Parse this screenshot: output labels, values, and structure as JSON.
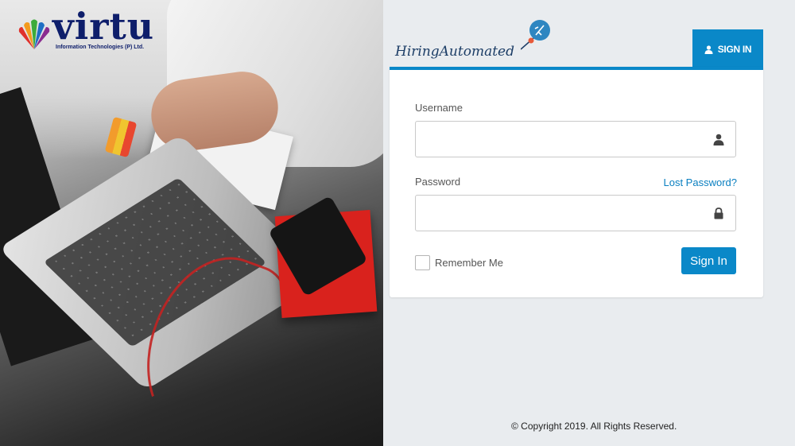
{
  "brand": {
    "name": "virtu",
    "tagline": "Information Technologies (P) Ltd."
  },
  "product": {
    "name": "HiringAutomated"
  },
  "tab": {
    "label": "SIGN IN"
  },
  "form": {
    "username_label": "Username",
    "username_value": "",
    "password_label": "Password",
    "password_value": "",
    "lost_password": "Lost Password?",
    "remember_label": "Remember Me",
    "remember_checked": false,
    "submit_label": "Sign In"
  },
  "footer": {
    "copyright": "© Copyright 2019. All Rights Reserved."
  },
  "colors": {
    "accent": "#0a88c8",
    "page_bg": "#e9ecef",
    "brand_navy": "#0e1e6b"
  },
  "icons": {
    "tab": "user-icon",
    "username": "user-icon",
    "password": "lock-icon",
    "product": "lightbulb-icon"
  }
}
